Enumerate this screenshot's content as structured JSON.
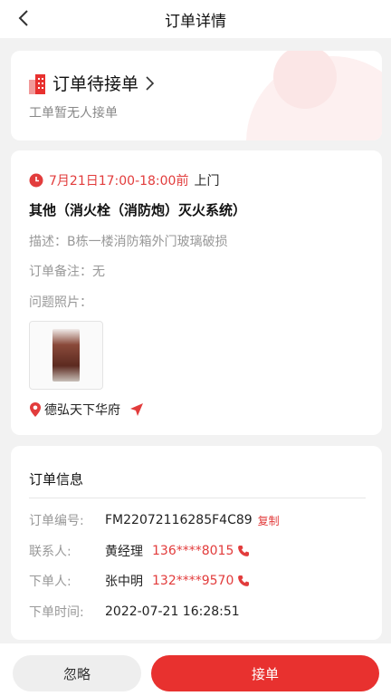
{
  "header": {
    "title": "订单详情"
  },
  "status": {
    "title": "订单待接单",
    "subtitle": "工单暂无人接单"
  },
  "appointment": {
    "time": "7月21日17:00-18:00前",
    "type": "上门"
  },
  "service": {
    "title": "其他（消火栓（消防炮）灭火系统）",
    "description": "描述：B栋一楼消防箱外门玻璃破损",
    "remark": "订单备注：无",
    "photo_label": "问题照片：",
    "location": "德弘天下华府"
  },
  "order_info": {
    "title": "订单信息",
    "order_no_label": "订单编号:",
    "order_no": "FM22072116285F4C89",
    "copy_label": "复制",
    "contact_label": "联系人:",
    "contact_name": "黄经理",
    "contact_phone": "136****8015",
    "orderer_label": "下单人:",
    "orderer_name": "张中明",
    "orderer_phone": "132****9570",
    "time_label": "下单时间:",
    "time": "2022-07-21 16:28:51"
  },
  "actions": {
    "ignore_label": "忽略",
    "accept_label": "接单"
  },
  "colors": {
    "accent": "#e8312f",
    "text_red": "#e23c3c",
    "background": "#f2f2f2"
  },
  "icons": [
    "back-arrow-icon",
    "building-icon",
    "chevron-right-icon",
    "clock-icon",
    "location-pin-icon",
    "navigation-arrow-icon",
    "phone-icon"
  ]
}
